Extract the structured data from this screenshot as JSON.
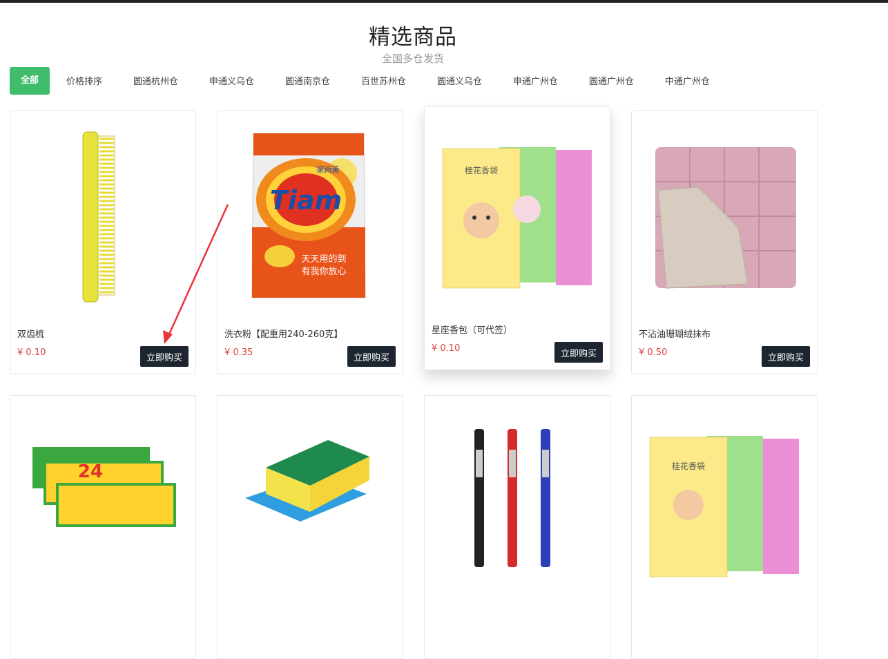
{
  "header": {
    "title": "精选商品",
    "subtitle": "全国多仓发货"
  },
  "filters": [
    {
      "label": "全部",
      "active": true
    },
    {
      "label": "价格排序"
    },
    {
      "label": "圆通杭州仓"
    },
    {
      "label": "申通义乌仓"
    },
    {
      "label": "圆通南京仓"
    },
    {
      "label": "百世苏州仓"
    },
    {
      "label": "圆通义乌仓"
    },
    {
      "label": "申通广州仓"
    },
    {
      "label": "圆通广州仓"
    },
    {
      "label": "中通广州仓"
    }
  ],
  "products": [
    {
      "name": "双齿梳",
      "price": "¥ 0.10",
      "buy_label": "立即购买",
      "icon": "comb-icon"
    },
    {
      "name": "洗衣粉【配重用240-260克】",
      "price": "¥ 0.35",
      "buy_label": "立即购买",
      "icon": "detergent-icon",
      "brand": "Tiam",
      "brand_cn": "家尚美",
      "slogan1": "天天用的到",
      "slogan2": "有我你放心"
    },
    {
      "name": "星座香包（可代签）",
      "price": "¥ 0.10",
      "buy_label": "立即购买",
      "icon": "sachet-icon",
      "pkg_text": "桂花香袋"
    },
    {
      "name": "不沾油珊瑚绒抹布",
      "price": "¥ 0.50",
      "buy_label": "立即购买",
      "icon": "cloth-icon"
    },
    {
      "icon": "soap-icon",
      "pkg_text": "24"
    },
    {
      "icon": "sponge-icon"
    },
    {
      "icon": "pens-icon"
    },
    {
      "icon": "sachet-icon",
      "pkg_text": "桂花香袋"
    }
  ],
  "colors": {
    "accent": "#3fbc6c",
    "button": "#1c2530",
    "price": "#d9443b",
    "annotation": "#e8333a"
  }
}
